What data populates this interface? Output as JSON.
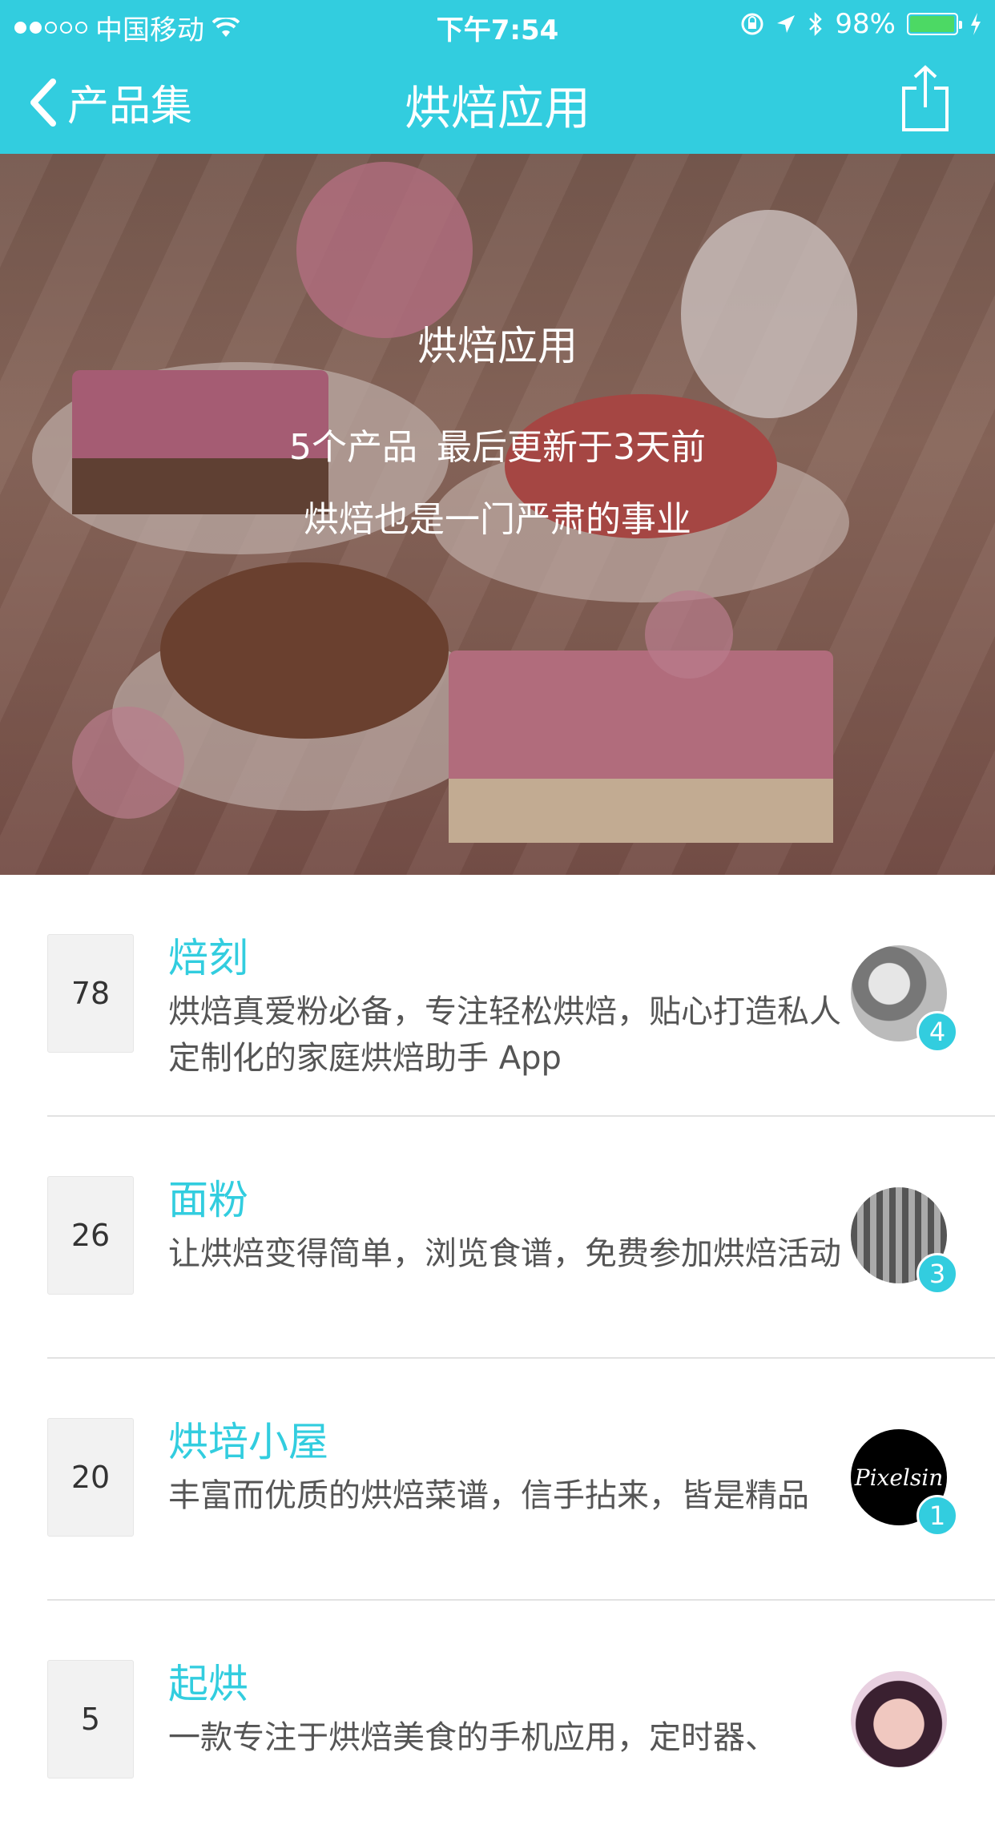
{
  "status_bar": {
    "carrier": "中国移动",
    "time": "下午7:54",
    "battery": "98%",
    "battery_level": 0.98,
    "icons": [
      "wifi-icon",
      "orientation-lock-icon",
      "location-arrow-icon",
      "bluetooth-icon",
      "battery-icon",
      "charging-icon"
    ]
  },
  "nav": {
    "back_label": "产品集",
    "title": "烘焙应用",
    "share_icon": "share-icon"
  },
  "hero": {
    "title": "烘焙应用",
    "meta_count": "5个产品",
    "meta_updated": "最后更新于3天前",
    "description": "烘焙也是一门严肃的事业"
  },
  "items": [
    {
      "votes": "78",
      "name": "焙刻",
      "description": "烘焙真爱粉必备，专注轻松烘焙，贴心打造私人定制化的家庭烘焙助手 App",
      "avatar_text": "",
      "badge": "4"
    },
    {
      "votes": "26",
      "name": "面粉",
      "description": "让烘焙变得简单，浏览食谱，免费参加烘焙活动",
      "avatar_text": "",
      "badge": "3"
    },
    {
      "votes": "20",
      "name": "烘培小屋",
      "description": "丰富而优质的烘焙菜谱，信手拈来，皆是精品",
      "avatar_text": "Pixelsin",
      "badge": "1"
    },
    {
      "votes": "5",
      "name": "起烘",
      "description": "一款专注于烘焙美食的手机应用，定时器、",
      "avatar_text": "",
      "badge": ""
    }
  ],
  "colors": {
    "accent": "#32cddf",
    "battery_fill": "#4cd964"
  }
}
